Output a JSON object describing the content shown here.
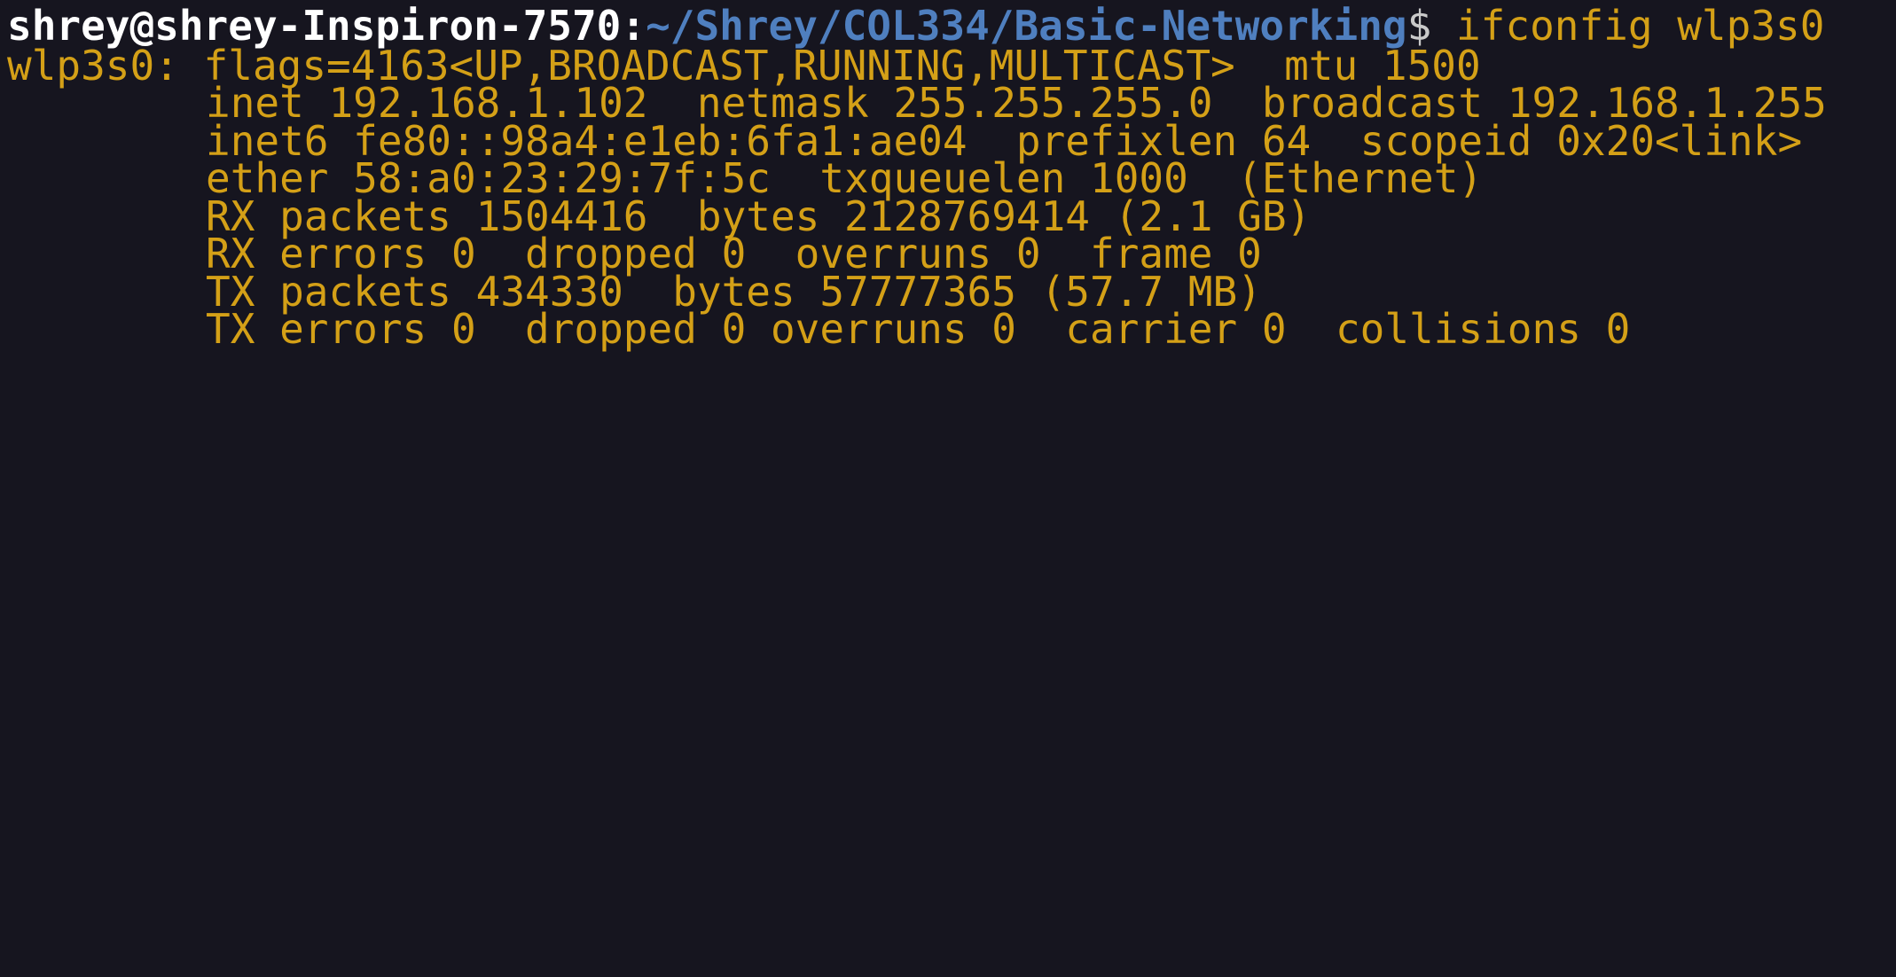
{
  "terminal": {
    "prompt": {
      "user_host": "shrey@shrey-Inspiron-7570",
      "separator": ":",
      "path": "~/Shrey/COL334/Basic-Networking",
      "symbol": "$ ",
      "command": "ifconfig wlp3s0"
    },
    "output": {
      "interface_line": "wlp3s0: flags=4163<UP,BROADCAST,RUNNING,MULTICAST>  mtu 1500",
      "inet_line": "inet 192.168.1.102  netmask 255.255.255.0  broadcast 192.168.1.255",
      "inet6_line": "inet6 fe80::98a4:e1eb:6fa1:ae04  prefixlen 64  scopeid 0x20<link>",
      "ether_line": "ether 58:a0:23:29:7f:5c  txqueuelen 1000  (Ethernet)",
      "rx_packets_line": "RX packets 1504416  bytes 2128769414 (2.1 GB)",
      "rx_errors_line": "RX errors 0  dropped 0  overruns 0  frame 0",
      "tx_packets_line": "TX packets 434330  bytes 57777365 (57.7 MB)",
      "tx_errors_line": "TX errors 0  dropped 0 overruns 0  carrier 0  collisions 0"
    }
  }
}
